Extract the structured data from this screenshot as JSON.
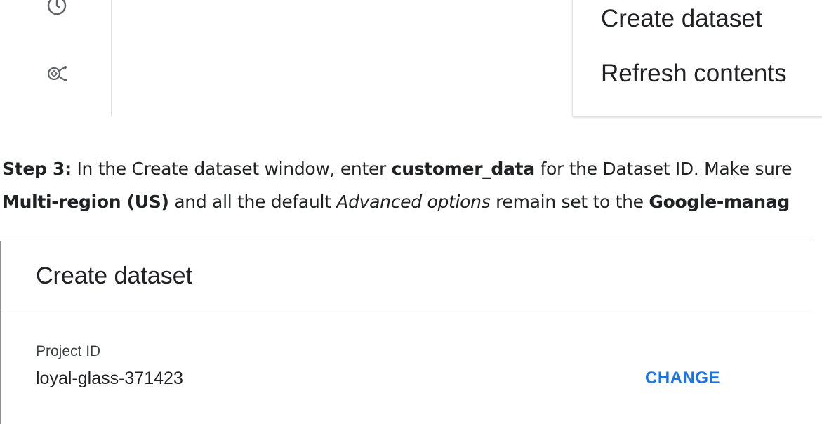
{
  "nav_rail": {
    "icons": [
      "history-icon",
      "analytics-hub-icon"
    ]
  },
  "context_menu": {
    "items": [
      "Create dataset",
      "Refresh contents"
    ]
  },
  "instructions": {
    "line1": {
      "step_label": "Step 3:",
      "text_before": " In the Create dataset window, enter ",
      "dataset_id": "customer_data",
      "text_after": " for the Dataset ID. Make sure"
    },
    "line2": {
      "location": "Multi-region (US)",
      "text_middle": " and all the default ",
      "advanced": "Advanced options",
      "text_after": " remain set to the ",
      "encryption": "Google-manag"
    }
  },
  "dialog": {
    "title": "Create dataset",
    "project_id_label": "Project ID",
    "project_id_value": "loyal-glass-371423",
    "change_label": "CHANGE"
  }
}
